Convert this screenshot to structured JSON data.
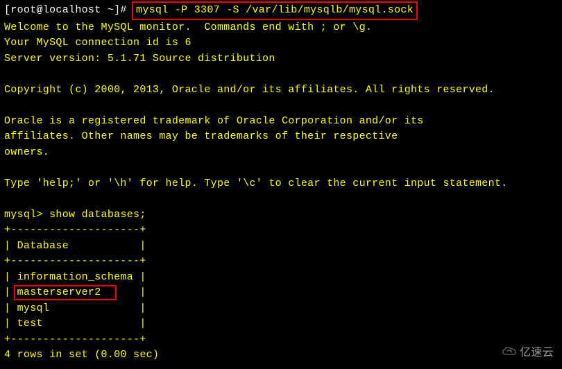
{
  "prompt": {
    "user_host": "[root@localhost ~]# ",
    "command": "mysql -P 3307 -S /var/lib/mysqlb/mysql.sock"
  },
  "welcome": {
    "line1": "Welcome to the MySQL monitor.  Commands end with ; or \\g.",
    "line2": "Your MySQL connection id is 6",
    "line3": "Server version: 5.1.71 Source distribution"
  },
  "copyright": "Copyright (c) 2000, 2013, Oracle and/or its affiliates. All rights reserved.",
  "trademark": {
    "line1": "Oracle is a registered trademark of Oracle Corporation and/or its",
    "line2": "affiliates. Other names may be trademarks of their respective",
    "line3": "owners."
  },
  "help": "Type 'help;' or '\\h' for help. Type '\\c' to clear the current input statement.",
  "mysql_prompt": "mysql> ",
  "query": "show databases;",
  "table": {
    "border": "+--------------------+",
    "header": "| Database           |",
    "rows": [
      "| information_schema |",
      "| masterserver2      |",
      "| mysql              |",
      "| test               |"
    ]
  },
  "result": "4 rows in set (0.00 sec)",
  "highlighted_db": "masterserver2",
  "watermark": "亿速云"
}
